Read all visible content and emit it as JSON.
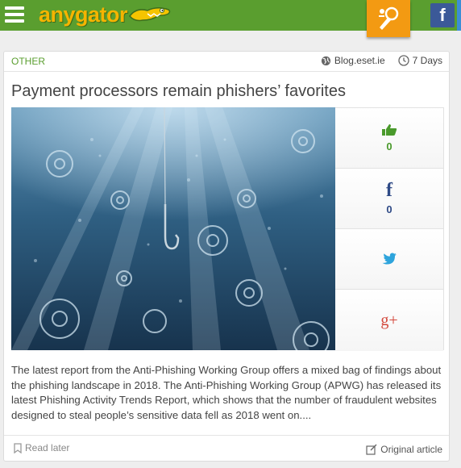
{
  "header": {
    "logo_text": "anygator",
    "menu_icon": "hamburger-icon",
    "promo_icon": "rocket-microphone-icon",
    "facebook_label": "f",
    "brand_green": "#5a9e2f",
    "accent_orange": "#f39a12"
  },
  "article": {
    "category": "OTHER",
    "source": "Blog.eset.ie",
    "age": "7 Days",
    "title": "Payment processors remain phishers’ favorites",
    "image_alt_icon": "phishing-hook-underwater-image",
    "excerpt": "The latest report from the Anti-Phishing Working Group offers a mixed bag of findings about the phishing landscape in 2018. The Anti-Phishing Working Group (APWG) has released its latest Phishing Activity Trends Report, which shows that the number of fraudulent websites designed to steal people’s sensitive data fell as 2018 went on...."
  },
  "social": {
    "likes": "0",
    "facebook_shares": "0",
    "facebook_label": "f",
    "twitter_icon": "twitter-bird-icon",
    "gplus_label": "g+"
  },
  "footer": {
    "read_later": "Read later",
    "original_article": "Original article"
  }
}
